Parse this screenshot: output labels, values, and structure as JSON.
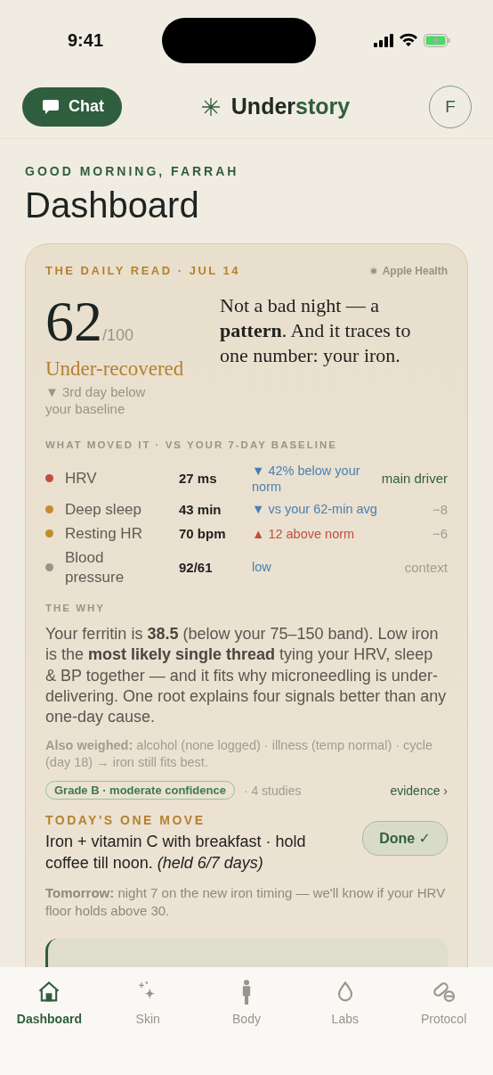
{
  "status_bar": {
    "time": "9:41"
  },
  "header": {
    "chat_button": "Chat",
    "brand": {
      "lead": "Under",
      "accent": "story"
    },
    "avatar": "F"
  },
  "greeting": "GOOD MORNING, FARRAH",
  "title": "Dashboard",
  "daily_read": {
    "eyebrow": "THE DAILY READ · JUL 14",
    "source": "Apple Health",
    "score": "62",
    "score_max": "/100",
    "status": "Under-recovered",
    "trend": "▼ 3rd day below your baseline",
    "headline": "Not a bad night — a **pattern**. And it traces to one number: your iron.",
    "metrics_heading": "WHAT MOVED IT · VS YOUR 7-DAY BASELINE",
    "metrics": [
      {
        "name": "HRV",
        "color": "#c0503e",
        "value": "27 ms",
        "delta": {
          "text": "▼ 42% below your norm",
          "color": "#4a7fb3"
        },
        "note": {
          "text": "main driver",
          "color": "#2f5e3f"
        }
      },
      {
        "name": "Deep sleep",
        "color": "#c48a2e",
        "value": "43 min",
        "delta": {
          "text": "▼ vs your 62-min avg",
          "color": "#4a7fb3"
        },
        "note": {
          "text": "−8",
          "color": "#a39b90"
        }
      },
      {
        "name": "Resting HR",
        "color": "#c48a2e",
        "value": "70 bpm",
        "delta": {
          "text": "▲ 12 above norm",
          "color": "#c0503e"
        },
        "note": {
          "text": "−6",
          "color": "#a39b90"
        }
      },
      {
        "name": "Blood pressure",
        "color": "#99948a",
        "value": "92/61",
        "delta": {
          "text": "low",
          "color": "#4a7fb3"
        },
        "note": {
          "text": "context",
          "color": "#a39b90"
        }
      }
    ],
    "why_heading": "THE WHY",
    "why_text": "Your ferritin is **38.5** (below your 75–150 band). Low iron is the **most likely single thread** tying your HRV, sleep & BP together — and it fits why microneedling is under-delivering. One root explains four signals better than any one-day cause.",
    "also_weighed": "**Also weighed:** alcohol (none logged) · illness (temp normal) · cycle (day 18) → iron still fits best.",
    "grade_badge": "Grade B · moderate confidence",
    "studies": "· 4 studies",
    "evidence_link": "evidence ›",
    "move_heading": "TODAY'S ONE MOVE",
    "move_text": "Iron + vitamin C with breakfast · hold coffee till noon.  *(held 6/7 days)*",
    "done_button": {
      "label": "Done ✓",
      "checked": true
    },
    "tomorrow": "**Tomorrow:** night 7 on the new iron timing — we'll know if your HRV floor holds above 30."
  },
  "tab_bar": [
    {
      "label": "Dashboard",
      "selected": true
    },
    {
      "label": "Skin",
      "selected": false
    },
    {
      "label": "Body",
      "selected": false
    },
    {
      "label": "Labs",
      "selected": false
    },
    {
      "label": "Protocol",
      "selected": false
    }
  ]
}
